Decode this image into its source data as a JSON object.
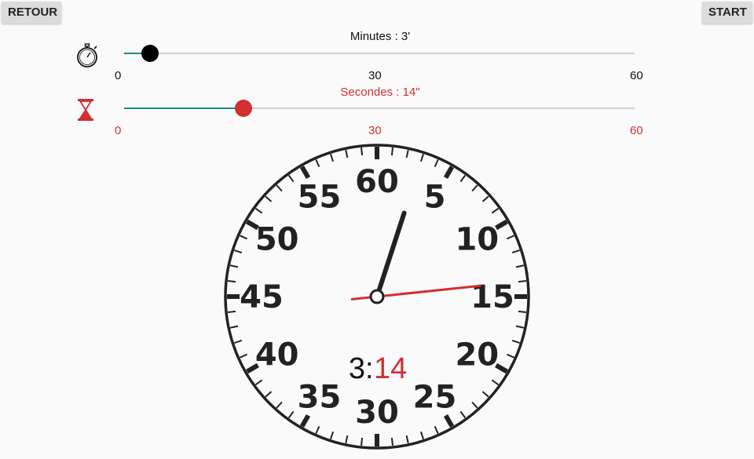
{
  "buttons": {
    "back_label": "RETOUR",
    "start_label": "START"
  },
  "minutes_slider": {
    "label": "Minutes : 3'",
    "value": 3,
    "min": 0,
    "max": 60,
    "tick_min": "0",
    "tick_mid": "30",
    "tick_max": "60",
    "color": "#000000",
    "icon": "stopwatch-icon"
  },
  "seconds_slider": {
    "label": "Secondes : 14\"",
    "value": 14,
    "min": 0,
    "max": 60,
    "tick_min": "0",
    "tick_mid": "30",
    "tick_max": "60",
    "color": "#d32f2f",
    "icon": "hourglass-icon"
  },
  "clock": {
    "numbers": [
      "60",
      "5",
      "10",
      "15",
      "20",
      "25",
      "30",
      "35",
      "40",
      "45",
      "50",
      "55"
    ],
    "readout_minutes": "3",
    "readout_separator": ":",
    "readout_seconds": "14",
    "minutes": 3,
    "seconds": 14
  },
  "colors": {
    "accent": "#d32f2f",
    "track_fill": "#1a8c7d",
    "track": "#cfcfcf",
    "dial": "#222222"
  }
}
